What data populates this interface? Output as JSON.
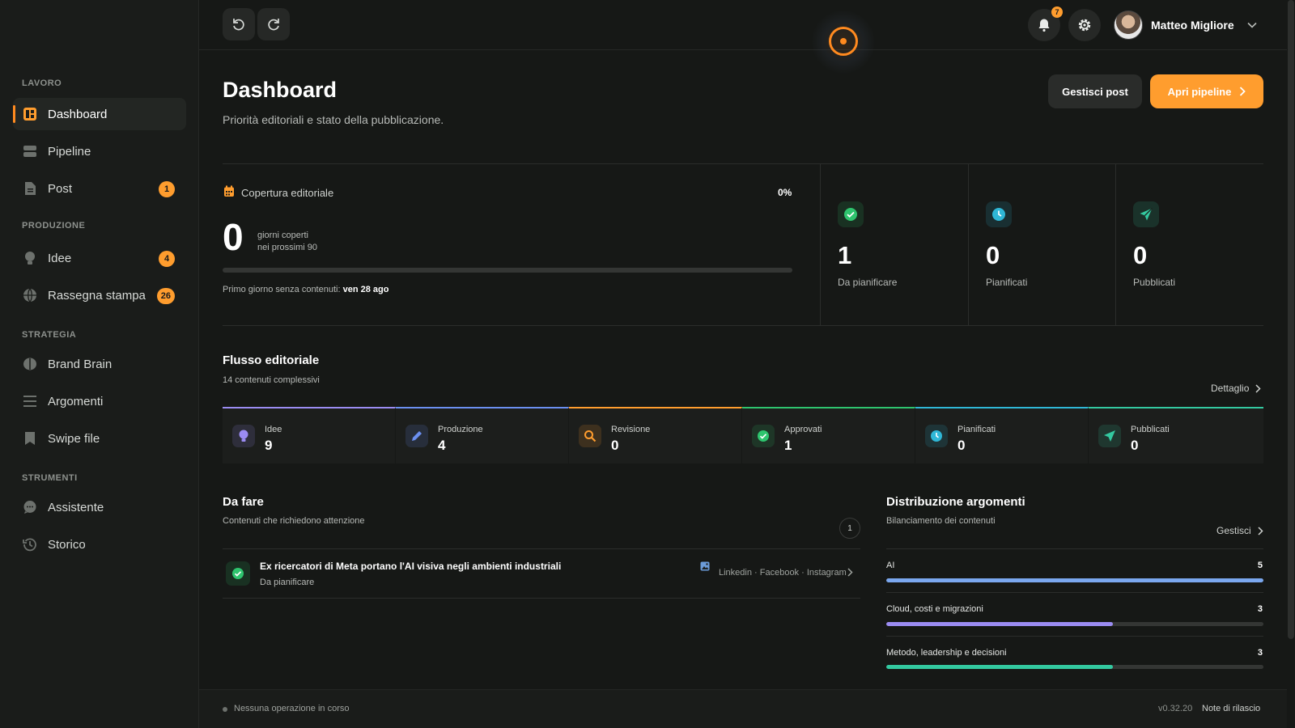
{
  "sidebar": {
    "sections": [
      "LAVORO",
      "PRODUZIONE",
      "STRATEGIA",
      "STRUMENTI"
    ],
    "items": [
      {
        "label": "Dashboard",
        "icon": "dashboard-icon"
      },
      {
        "label": "Pipeline",
        "icon": "pipeline-icon"
      },
      {
        "label": "Post",
        "icon": "document-icon",
        "badge": "1"
      },
      {
        "label": "Idee",
        "icon": "lightbulb-icon",
        "badge": "4"
      },
      {
        "label": "Rassegna stampa",
        "icon": "globe-icon",
        "badge": "26"
      },
      {
        "label": "Brand Brain",
        "icon": "brain-icon"
      },
      {
        "label": "Argomenti",
        "icon": "list-icon"
      },
      {
        "label": "Swipe file",
        "icon": "bookmark-icon"
      },
      {
        "label": "Assistente",
        "icon": "chat-icon"
      },
      {
        "label": "Storico",
        "icon": "history-icon"
      }
    ]
  },
  "topbar": {
    "notification_count": "7",
    "user_name": "Matteo Migliore"
  },
  "header": {
    "title": "Dashboard",
    "subtitle": "Priorità editoriali e stato della pubblicazione.",
    "secondary_button": "Gestisci post",
    "primary_button": "Apri pipeline"
  },
  "coverage": {
    "label": "Copertura editoriale",
    "percent": "0%",
    "progress_fraction": 0,
    "value": "0",
    "desc_line1": "giorni coperti",
    "desc_line2": "nei prossimi 90",
    "first_empty_prefix": "Primo giorno senza contenuti:",
    "first_empty_date": "ven 28 ago"
  },
  "stats": [
    {
      "value": "1",
      "label": "Da pianificare",
      "icon": "check-circle-icon",
      "color": "#2ec46e"
    },
    {
      "value": "0",
      "label": "Pianificati",
      "icon": "clock-icon",
      "color": "#2fb7d6"
    },
    {
      "value": "0",
      "label": "Pubblicati",
      "icon": "send-icon",
      "color": "#33c9a0"
    }
  ],
  "flow": {
    "title": "Flusso editoriale",
    "subtitle": "14 contenuti complessivi",
    "link": "Dettaglio",
    "stages": [
      {
        "label": "Idee",
        "value": "9",
        "icon": "lightbulb-icon",
        "color": "#9b8cf2"
      },
      {
        "label": "Produzione",
        "value": "4",
        "icon": "pencil-icon",
        "color": "#6b8ff0"
      },
      {
        "label": "Revisione",
        "value": "0",
        "icon": "search-icon",
        "color": "#ff9d2e"
      },
      {
        "label": "Approvati",
        "value": "1",
        "icon": "check-circle-icon",
        "color": "#2ec46e"
      },
      {
        "label": "Pianificati",
        "value": "0",
        "icon": "clock-icon",
        "color": "#2fb7d6"
      },
      {
        "label": "Pubblicati",
        "value": "0",
        "icon": "send-icon",
        "color": "#33c9a0"
      }
    ]
  },
  "todo": {
    "title": "Da fare",
    "subtitle": "Contenuti che richiedono attenzione",
    "count": "1",
    "items": [
      {
        "title": "Ex ricercatori di Meta portano l'AI visiva negli ambienti industriali",
        "status": "Da pianificare",
        "channels": "Linkedin · Facebook · Instagram"
      }
    ]
  },
  "distribution": {
    "title": "Distribuzione argomenti",
    "subtitle": "Bilanciamento dei contenuti",
    "link": "Gestisci",
    "items": [
      {
        "label": "AI",
        "value": "5",
        "fraction": 1.0,
        "color": "#7aa7ee"
      },
      {
        "label": "Cloud, costi e migrazioni",
        "value": "3",
        "fraction": 0.6,
        "color": "#9b8cf2"
      },
      {
        "label": "Metodo, leadership e decisioni",
        "value": "3",
        "fraction": 0.6,
        "color": "#33c9a0"
      }
    ]
  },
  "statusbar": {
    "status": "Nessuna operazione in corso",
    "version": "v0.32.20",
    "release_notes": "Note di rilascio"
  },
  "colors": {
    "accent": "#ff9d2e",
    "background": "#161816",
    "sidebar": "#1a1c1a"
  }
}
